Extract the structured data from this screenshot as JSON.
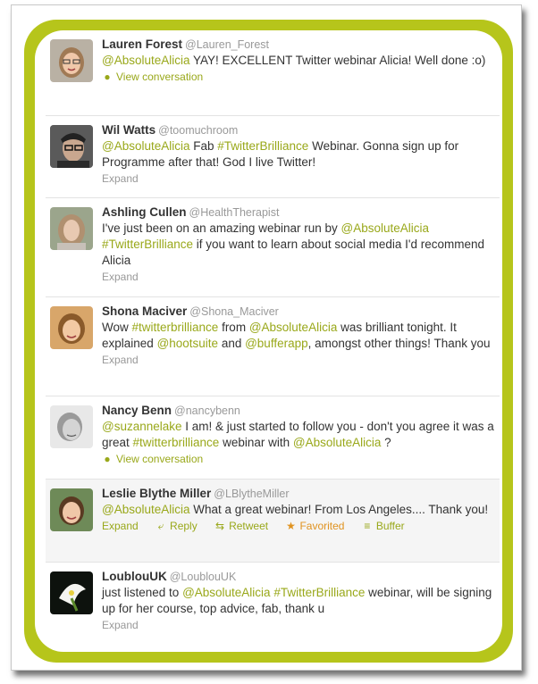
{
  "tweets": [
    {
      "name": "Lauren Forest",
      "handle": "@Lauren_Forest",
      "text": [
        {
          "t": "@AbsoluteAlicia",
          "link": true
        },
        {
          "t": " YAY! EXCELLENT Twitter webinar Alicia! Well done :o)",
          "link": false
        }
      ],
      "action": "View conversation"
    },
    {
      "name": "Wil Watts",
      "handle": "@toomuchroom",
      "text": [
        {
          "t": "@AbsoluteAlicia",
          "link": true
        },
        {
          "t": " Fab ",
          "link": false
        },
        {
          "t": "#TwitterBrilliance",
          "link": true
        },
        {
          "t": " Webinar. Gonna sign up for Programme after that! God I live Twitter!",
          "link": false
        }
      ],
      "action": "Expand"
    },
    {
      "name": "Ashling Cullen",
      "handle": "@HealthTherapist",
      "text": [
        {
          "t": "I've just been on an amazing webinar run by ",
          "link": false
        },
        {
          "t": "@AbsoluteAlicia",
          "link": true
        },
        {
          "t": " ",
          "link": false
        },
        {
          "t": "#TwitterBrilliance",
          "link": true
        },
        {
          "t": " if you want to learn about social media I'd recommend Alicia",
          "link": false
        }
      ],
      "action": "Expand"
    },
    {
      "name": "Shona Maciver",
      "handle": "@Shona_Maciver",
      "text": [
        {
          "t": "Wow ",
          "link": false
        },
        {
          "t": "#twitterbrilliance",
          "link": true
        },
        {
          "t": " from ",
          "link": false
        },
        {
          "t": "@AbsoluteAlicia",
          "link": true
        },
        {
          "t": " was brilliant tonight. It explained ",
          "link": false
        },
        {
          "t": "@hootsuite",
          "link": true
        },
        {
          "t": " and ",
          "link": false
        },
        {
          "t": "@bufferapp",
          "link": true
        },
        {
          "t": ", amongst other things! Thank you",
          "link": false
        }
      ],
      "action": "Expand"
    },
    {
      "name": "Nancy Benn",
      "handle": "@nancybenn",
      "text": [
        {
          "t": "@suzannelake",
          "link": true
        },
        {
          "t": " I am! & just started to follow you - don't you agree it was a great ",
          "link": false
        },
        {
          "t": "#twitterbrilliance",
          "link": true
        },
        {
          "t": " webinar with ",
          "link": false
        },
        {
          "t": "@AbsoluteAlicia",
          "link": true
        },
        {
          "t": " ?",
          "link": false
        }
      ],
      "action": "View conversation"
    },
    {
      "name": "Leslie Blythe Miller",
      "handle": "@LBlytheMiller",
      "text": [
        {
          "t": "@AbsoluteAlicia",
          "link": true
        },
        {
          "t": " What a great webinar! From Los Angeles.... Thank you!",
          "link": false
        }
      ],
      "action": "Expand",
      "extra_actions": [
        "Reply",
        "Retweet",
        "Favorited",
        "Buffer"
      ]
    },
    {
      "name": "LoublouUK",
      "handle": "@LoublouUK",
      "text": [
        {
          "t": "just listened to ",
          "link": false
        },
        {
          "t": "@AbsoluteAlicia",
          "link": true
        },
        {
          "t": " ",
          "link": false
        },
        {
          "t": "#TwitterBrilliance",
          "link": true
        },
        {
          "t": " webinar, will be signing up for her course, top advice, fab, thank u",
          "link": false
        }
      ],
      "action": "Expand"
    }
  ],
  "colors": {
    "accent": "#99a81a",
    "border": "#b6c51b",
    "favorite": "#e09320"
  }
}
